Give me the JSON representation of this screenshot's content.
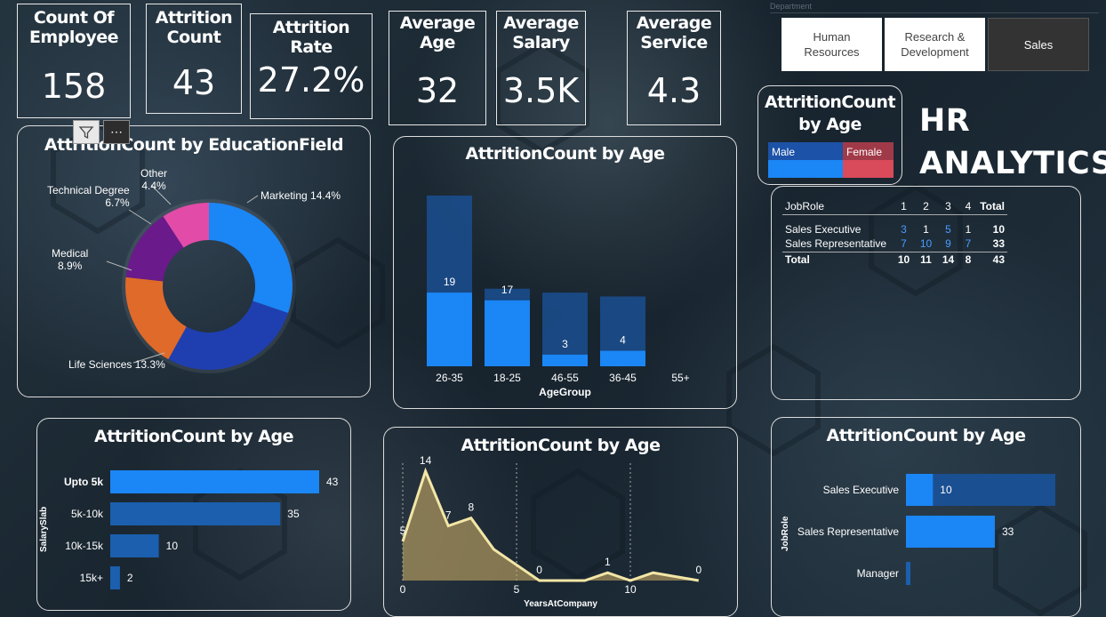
{
  "kpis": [
    {
      "title_l1": "Count Of",
      "title_l2": "Employee",
      "value": "158"
    },
    {
      "title_l1": "Attrition",
      "title_l2": "Count",
      "value": "43"
    },
    {
      "title_l1": "Attrition Rate",
      "title_l2": "",
      "value": "27.2%"
    },
    {
      "title_l1": "Average",
      "title_l2": "Age",
      "value": "32"
    },
    {
      "title_l1": "Average",
      "title_l2": "Salary",
      "value": "3.5K"
    },
    {
      "title_l1": "Average",
      "title_l2": "Service",
      "value": "4.3"
    }
  ],
  "slicer": {
    "label": "Department",
    "options": [
      {
        "l1": "Human",
        "l2": "Resources"
      },
      {
        "l1": "Research &",
        "l2": "Development"
      },
      {
        "l1": "Sales",
        "l2": ""
      }
    ],
    "selected": "Sales"
  },
  "gender_card": {
    "title_l1": "AttritionCount",
    "title_l2": "by Age",
    "male": "Male",
    "female": "Female"
  },
  "hr_title": {
    "l1": "HR",
    "l2": "ANALYTICS"
  },
  "matrix": {
    "headers": [
      "JobRole",
      "1",
      "2",
      "3",
      "4",
      "Total"
    ],
    "rows": [
      {
        "role": "Sales Executive",
        "c1": "3",
        "c2": "1",
        "c3": "5",
        "c4": "1",
        "total": "10"
      },
      {
        "role": "Sales Representative",
        "c1": "7",
        "c2": "10",
        "c3": "9",
        "c4": "7",
        "total": "33"
      },
      {
        "role": "Total",
        "c1": "10",
        "c2": "11",
        "c3": "14",
        "c4": "8",
        "total": "43"
      }
    ]
  },
  "edu_chart": {
    "title": "AttritionCount by EducationField",
    "labels": [
      {
        "name": "Other",
        "pct": "4.4%"
      },
      {
        "name": "Technical Degree",
        "pct": "6.7%"
      },
      {
        "name": "Marketing",
        "pct": "14.4%"
      },
      {
        "name": "Medical",
        "pct": "8.9%"
      },
      {
        "name": "Life Sciences",
        "pct": "13.3%"
      }
    ]
  },
  "chart_data": [
    {
      "type": "pie",
      "title": "AttritionCount by EducationField",
      "categories": [
        "Marketing",
        "Life Sciences",
        "Medical",
        "Technical Degree",
        "Other"
      ],
      "values": [
        14.4,
        13.3,
        8.9,
        6.7,
        4.4
      ],
      "colors": [
        "#1b86f5",
        "#1f3fb0",
        "#e06a2a",
        "#6a1a8a",
        "#e34ba8"
      ]
    },
    {
      "type": "bar",
      "title": "AttritionCount by Age",
      "xlabel": "AgeGroup",
      "categories": [
        "26-35",
        "18-25",
        "46-55",
        "36-45",
        "55+"
      ],
      "values": [
        19,
        17,
        3,
        4,
        0
      ],
      "background_values": [
        44,
        20,
        19,
        18,
        0
      ]
    },
    {
      "type": "bar",
      "orientation": "horizontal",
      "title": "AttritionCount by Age",
      "ylabel": "SalarySlab",
      "categories": [
        "Upto 5k",
        "5k-10k",
        "10k-15k",
        "15k+"
      ],
      "values": [
        43,
        35,
        10,
        2
      ]
    },
    {
      "type": "area",
      "title": "AttritionCount by Age",
      "xlabel": "YearsAtCompany",
      "x": [
        0,
        1,
        2,
        3,
        4,
        5,
        6,
        7,
        8,
        9,
        10,
        11,
        12,
        13
      ],
      "y": [
        5,
        14,
        7,
        8,
        4,
        2,
        0,
        0,
        0,
        1,
        0,
        1,
        0.5,
        0
      ],
      "point_labels": [
        {
          "x": 0,
          "label": "5"
        },
        {
          "x": 1,
          "label": "14"
        },
        {
          "x": 2,
          "label": "7"
        },
        {
          "x": 3,
          "label": "8"
        },
        {
          "x": 6,
          "label": "0"
        },
        {
          "x": 9,
          "label": "1"
        },
        {
          "x": 13,
          "label": "0"
        }
      ],
      "xticks": [
        "0",
        "5",
        "10"
      ]
    },
    {
      "type": "bar",
      "orientation": "horizontal",
      "title": "AttritionCount by Age",
      "ylabel": "JobRole",
      "categories": [
        "Sales Executive",
        "Sales Representative",
        "Manager"
      ],
      "values": [
        10,
        33,
        0
      ],
      "background_values": [
        60,
        0,
        0
      ]
    }
  ],
  "colors": {
    "accent": "#1b86f5",
    "female": "#d94a5a",
    "panel_border": "#dcdcdc"
  }
}
